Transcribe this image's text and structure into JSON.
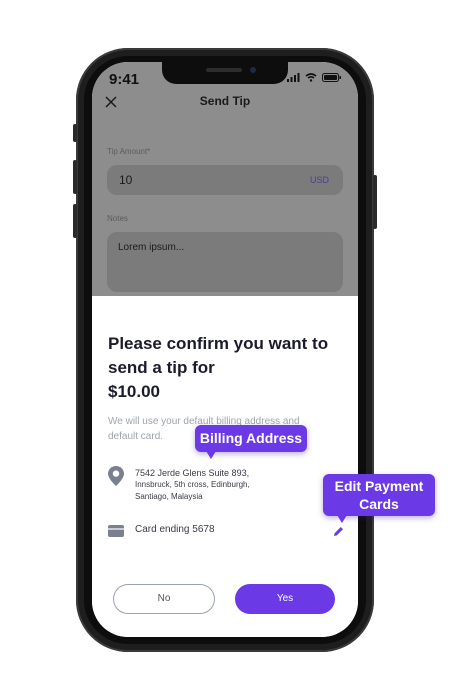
{
  "status_bar": {
    "time": "9:41"
  },
  "header": {
    "title": "Send Tip",
    "close_icon": "close-icon"
  },
  "form": {
    "amount_label": "Tip Amount*",
    "amount_value": "10",
    "currency": "USD",
    "notes_label": "Notes",
    "notes_value": "Lorem ipsum..."
  },
  "sheet": {
    "confirm_line1": "Please confirm you want to send a tip for",
    "confirm_amount": "$10.00",
    "description": "We will use your default billing address and default card.",
    "address": {
      "line1": "7542 Jerde Glens Suite 893,",
      "line2": "Innsbruck, 5th cross, Edinburgh,",
      "line3": "Santiago, Malaysia",
      "icon": "location-pin-icon"
    },
    "card": {
      "text": "Card ending 5678",
      "icon": "credit-card-icon",
      "edit_icon": "pencil-icon"
    },
    "buttons": {
      "no": "No",
      "yes": "Yes"
    }
  },
  "annotations": {
    "billing_address": "Billing Address",
    "edit_payment_cards": "Edit Payment Cards"
  },
  "colors": {
    "accent": "#6b3ae6",
    "overlay": "#8d8d8d",
    "muted_text": "#9ea4b0"
  }
}
